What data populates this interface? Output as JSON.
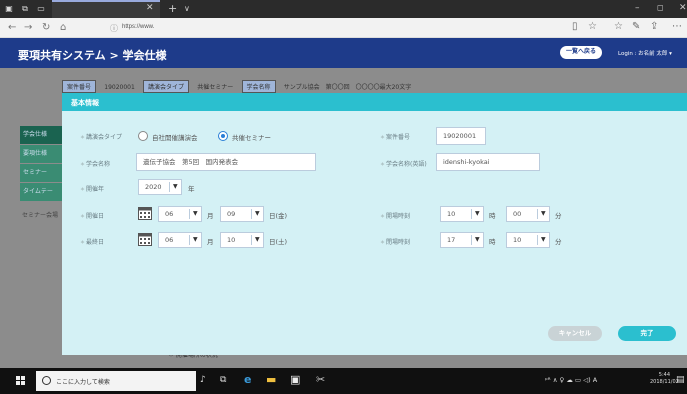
{
  "browser": {
    "url": "https://www."
  },
  "app": {
    "title": "要項共有システム > 学会仕様",
    "back_button": "一覧へ戻る",
    "login_label": "Login : お名前 太郎 ▾"
  },
  "background": {
    "chips": [
      "案件番号",
      "19020001",
      "講演会タイプ",
      "共催セミナー",
      "学会名称",
      "サンプル協会　第〇〇回　〇〇〇〇最大20文字"
    ],
    "sidebar": [
      "学会仕様",
      "要項仕様",
      "セミナー",
      "タイムテー"
    ],
    "sidebar_extra": "セミナー会場",
    "bottom_text": "＊ 開催場所の状況"
  },
  "modal": {
    "title": "基本情報",
    "lecture_type": {
      "label": "講演会タイプ",
      "options": [
        "自社開催講演会",
        "共催セミナー"
      ],
      "selected": "共催セミナー"
    },
    "case_number": {
      "label": "案件番号",
      "value": "19020001"
    },
    "society_name": {
      "label": "学会名称",
      "value": "遺伝子協会　第5回　国内発表会"
    },
    "society_name_en": {
      "label": "学会名称(英語)",
      "value": "idenshi-kyokai"
    },
    "year": {
      "label": "開催年",
      "value": "2020",
      "unit": "年"
    },
    "start_date": {
      "label": "開催日",
      "month": "06",
      "day": "09",
      "month_unit": "月",
      "day_unit": "日(金)"
    },
    "end_date": {
      "label": "最終日",
      "month": "06",
      "day": "10",
      "month_unit": "月",
      "day_unit": "日(土)"
    },
    "start_time": {
      "label": "開場時刻",
      "hour": "10",
      "minute": "00",
      "hour_unit": "時",
      "minute_unit": "分"
    },
    "end_time": {
      "label": "閉場時刻",
      "hour": "17",
      "minute": "10",
      "hour_unit": "時",
      "minute_unit": "分"
    },
    "cancel_button": "キャンセル",
    "done_button": "完了"
  },
  "taskbar": {
    "search_placeholder": "ここに入力して検索",
    "tray": "ᵖᴿ ∧ ♀ ☁ ▭ ◁) A",
    "time": "5:44",
    "date": "2018/11/02"
  },
  "colors": {
    "app_header": "#1e3b8a",
    "modal_accent": "#2bbfcf",
    "modal_bg": "#d4f1f5"
  }
}
